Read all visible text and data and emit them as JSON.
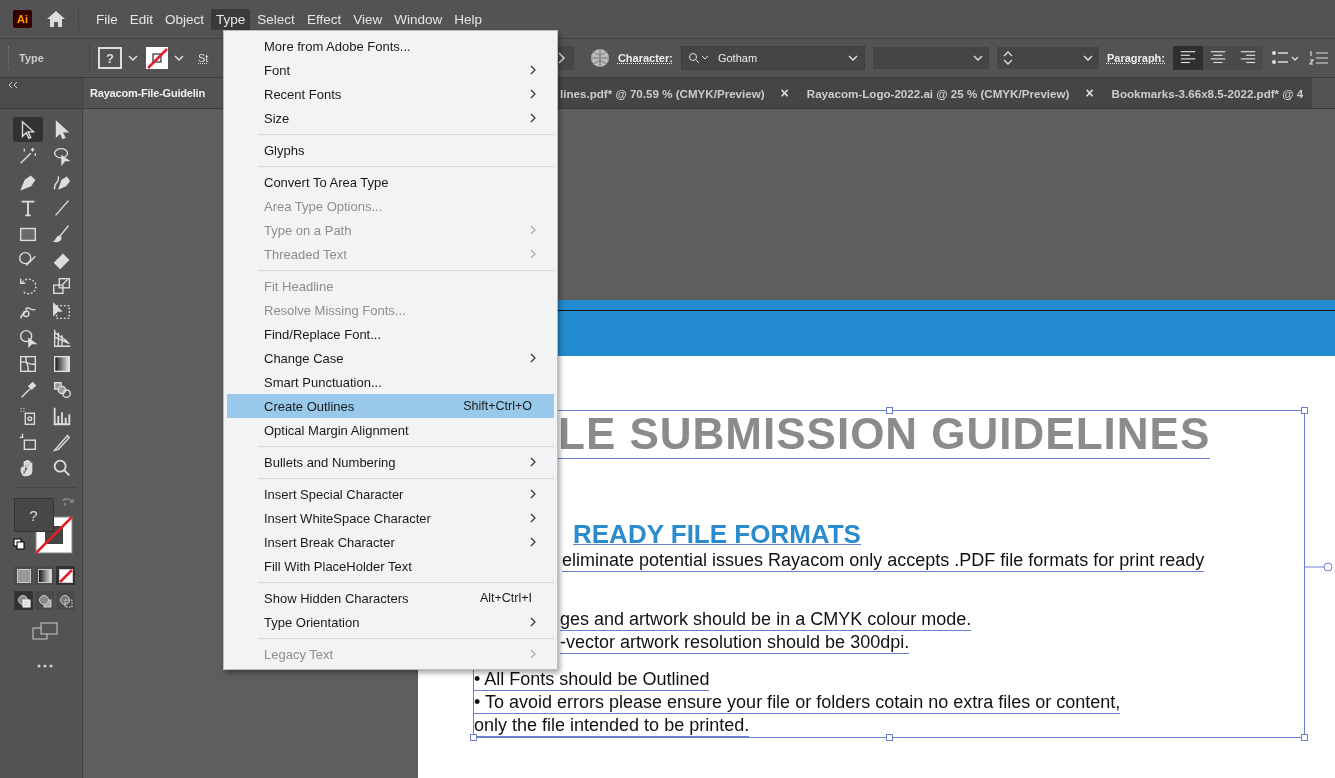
{
  "app": {
    "logo": "Ai"
  },
  "menubar": [
    {
      "label": "File",
      "selected": false
    },
    {
      "label": "Edit",
      "selected": false
    },
    {
      "label": "Object",
      "selected": false
    },
    {
      "label": "Type",
      "selected": true
    },
    {
      "label": "Select",
      "selected": false
    },
    {
      "label": "Effect",
      "selected": false
    },
    {
      "label": "View",
      "selected": false
    },
    {
      "label": "Window",
      "selected": false
    },
    {
      "label": "Help",
      "selected": false
    }
  ],
  "control_bar": {
    "context": "Type",
    "fill_swatch": "?",
    "stroke_label": "St",
    "character_label": "Character:",
    "font_field": "Gotham",
    "paragraph_label": "Paragraph:",
    "align_buttons": [
      {
        "kind": "left",
        "selected": true
      },
      {
        "kind": "center",
        "selected": false
      },
      {
        "kind": "right",
        "selected": false
      }
    ]
  },
  "tabs": [
    {
      "label": "Rayacom-File-Guidelin",
      "selected": true
    },
    {
      "label": "lines.pdf* @ 70.59 % (CMYK/Preview)",
      "selected": false,
      "close": "×"
    },
    {
      "label": "Rayacom-Logo-2022.ai @ 25 % (CMYK/Preview)",
      "selected": false,
      "close": "×"
    },
    {
      "label": "Bookmarks-3.66x8.5-2022.pdf* @ 4",
      "selected": false
    }
  ],
  "tools": [
    {
      "kind": "selection",
      "selected": true
    },
    {
      "kind": "direct",
      "selected": false
    },
    {
      "kind": "wand",
      "selected": false
    },
    {
      "kind": "lasso",
      "selected": false
    },
    {
      "kind": "pen",
      "selected": false
    },
    {
      "kind": "curvature",
      "selected": false
    },
    {
      "kind": "type",
      "selected": false
    },
    {
      "kind": "line",
      "selected": false
    },
    {
      "kind": "rectangle",
      "selected": false
    },
    {
      "kind": "brush",
      "selected": false
    },
    {
      "kind": "shaper",
      "selected": false
    },
    {
      "kind": "eraser",
      "selected": false
    },
    {
      "kind": "rotate",
      "selected": false
    },
    {
      "kind": "scale",
      "selected": false
    },
    {
      "kind": "warp",
      "selected": false
    },
    {
      "kind": "transform",
      "selected": false
    },
    {
      "kind": "builder",
      "selected": false
    },
    {
      "kind": "perspective",
      "selected": false
    },
    {
      "kind": "mesh",
      "selected": false
    },
    {
      "kind": "gradient",
      "selected": false
    },
    {
      "kind": "eyedropper",
      "selected": false
    },
    {
      "kind": "blend",
      "selected": false
    },
    {
      "kind": "sprayer",
      "selected": false
    },
    {
      "kind": "graph",
      "selected": false
    },
    {
      "kind": "artboard",
      "selected": false
    },
    {
      "kind": "knife",
      "selected": false
    },
    {
      "kind": "hand",
      "selected": false
    },
    {
      "kind": "zoom",
      "selected": false
    }
  ],
  "fill_stroke": {
    "fill": "?"
  },
  "color_modes": [
    {
      "kind": "color",
      "selected": false
    },
    {
      "kind": "gradient",
      "selected": false
    },
    {
      "kind": "none",
      "selected": true
    }
  ],
  "draw_modes": [
    {
      "kind": "normal",
      "selected": true
    },
    {
      "kind": "behind",
      "selected": false
    },
    {
      "kind": "inside",
      "selected": false
    }
  ],
  "type_menu": [
    [
      {
        "label": "More from Adobe Fonts...",
        "submenu": false,
        "disabled": false,
        "selected": false
      },
      {
        "label": "Font",
        "submenu": true,
        "disabled": false,
        "selected": false
      },
      {
        "label": "Recent Fonts",
        "submenu": true,
        "disabled": false,
        "selected": false
      },
      {
        "label": "Size",
        "submenu": true,
        "disabled": false,
        "selected": false
      }
    ],
    [
      {
        "label": "Glyphs",
        "submenu": false,
        "disabled": false,
        "selected": false
      }
    ],
    [
      {
        "label": "Convert To Area Type",
        "submenu": false,
        "disabled": false,
        "selected": false
      },
      {
        "label": "Area Type Options...",
        "submenu": false,
        "disabled": true,
        "selected": false
      },
      {
        "label": "Type on a Path",
        "submenu": true,
        "disabled": true,
        "selected": false
      },
      {
        "label": "Threaded Text",
        "submenu": true,
        "disabled": true,
        "selected": false
      }
    ],
    [
      {
        "label": "Fit Headline",
        "submenu": false,
        "disabled": true,
        "selected": false
      },
      {
        "label": "Resolve Missing Fonts...",
        "submenu": false,
        "disabled": true,
        "selected": false
      },
      {
        "label": "Find/Replace Font...",
        "submenu": false,
        "disabled": false,
        "selected": false
      },
      {
        "label": "Change Case",
        "submenu": true,
        "disabled": false,
        "selected": false
      },
      {
        "label": "Smart Punctuation...",
        "submenu": false,
        "disabled": false,
        "selected": false
      },
      {
        "label": "Create Outlines",
        "shortcut": "Shift+Ctrl+O",
        "submenu": false,
        "disabled": false,
        "selected": true
      },
      {
        "label": "Optical Margin Alignment",
        "submenu": false,
        "disabled": false,
        "selected": false
      }
    ],
    [
      {
        "label": "Bullets and Numbering",
        "submenu": true,
        "disabled": false,
        "selected": false
      }
    ],
    [
      {
        "label": "Insert Special Character",
        "submenu": true,
        "disabled": false,
        "selected": false
      },
      {
        "label": "Insert WhiteSpace Character",
        "submenu": true,
        "disabled": false,
        "selected": false
      },
      {
        "label": "Insert Break Character",
        "submenu": true,
        "disabled": false,
        "selected": false
      },
      {
        "label": "Fill With PlaceHolder Text",
        "submenu": false,
        "disabled": false,
        "selected": false
      }
    ],
    [
      {
        "label": "Show Hidden Characters",
        "shortcut": "Alt+Ctrl+I",
        "submenu": false,
        "disabled": false,
        "selected": false
      },
      {
        "label": "Type Orientation",
        "submenu": true,
        "disabled": false,
        "selected": false
      }
    ],
    [
      {
        "label": "Legacy Text",
        "submenu": true,
        "disabled": true,
        "selected": false
      }
    ]
  ],
  "document": {
    "title_fragment": "LE SUBMISSION GUIDELINES",
    "heading_fragment": "READY FILE FORMATS",
    "body_fragments": [
      "eliminate potential issues Rayacom only accepts .PDF file formats for print ready",
      "ges and artwork should be in a CMYK colour mode.",
      "-vector artwork resolution should be 300dpi."
    ],
    "body_lines": [
      "• All Fonts should be Outlined",
      "• To avoid errors please ensure your file or folders cotain no extra files or content,",
      "only the file intended to be printed."
    ]
  }
}
